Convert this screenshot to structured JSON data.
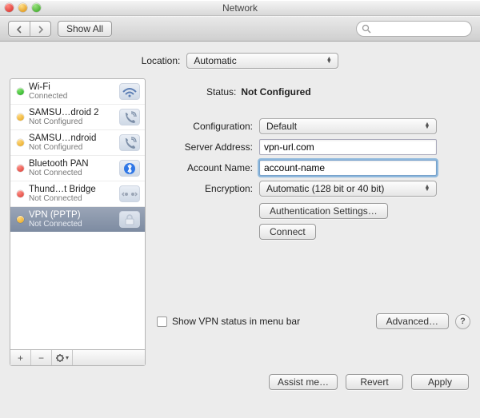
{
  "window": {
    "title": "Network"
  },
  "toolbar": {
    "show_all_label": "Show All"
  },
  "search": {
    "placeholder": ""
  },
  "location": {
    "label": "Location:",
    "selected": "Automatic"
  },
  "services": [
    {
      "name": "Wi-Fi",
      "state": "Connected",
      "dot": "green",
      "icon": "wifi"
    },
    {
      "name": "SAMSU…droid 2",
      "state": "Not Configured",
      "dot": "amber",
      "icon": "phone"
    },
    {
      "name": "SAMSU…ndroid",
      "state": "Not Configured",
      "dot": "amber",
      "icon": "phone"
    },
    {
      "name": "Bluetooth PAN",
      "state": "Not Connected",
      "dot": "red",
      "icon": "bluetooth"
    },
    {
      "name": "Thund…t Bridge",
      "state": "Not Connected",
      "dot": "red",
      "icon": "bridge"
    },
    {
      "name": "VPN (PPTP)",
      "state": "Not Connected",
      "dot": "amber",
      "icon": "lock",
      "selected": true
    }
  ],
  "status": {
    "label": "Status:",
    "value": "Not Configured"
  },
  "configuration": {
    "label": "Configuration:",
    "value": "Default"
  },
  "server": {
    "label": "Server Address:",
    "value": "vpn-url.com"
  },
  "account": {
    "label": "Account Name:",
    "value": "account-name"
  },
  "encryption": {
    "label": "Encryption:",
    "value": "Automatic (128 bit or 40 bit)"
  },
  "buttons": {
    "auth": "Authentication Settings…",
    "connect": "Connect",
    "show_vpn_status": "Show VPN status in menu bar",
    "advanced": "Advanced…",
    "assist": "Assist me…",
    "revert": "Revert",
    "apply": "Apply"
  },
  "footer_buttons": {
    "add": "+",
    "remove": "−",
    "gear": "✻▾"
  }
}
